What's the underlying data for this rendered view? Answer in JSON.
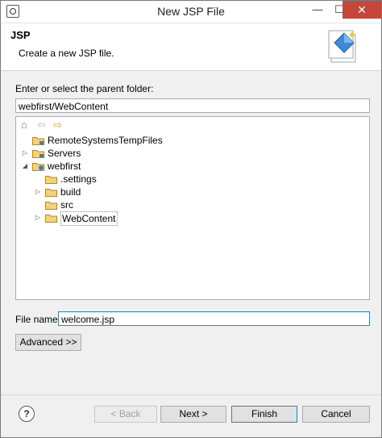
{
  "window": {
    "title": "New JSP File",
    "minimize_glyph": "—",
    "maximize_glyph": "☐",
    "close_glyph": "✕"
  },
  "header": {
    "title": "JSP",
    "description": "Create a new JSP file.",
    "icon": "jsp-wizard-icon"
  },
  "parent_folder": {
    "label": "Enter or select the parent folder:",
    "value": "webfirst/WebContent"
  },
  "tree": {
    "toolbar": [
      "home-icon",
      "back-arrow-icon",
      "forward-arrow-icon"
    ],
    "items": [
      {
        "label": "RemoteSystemsTempFiles",
        "expander": "",
        "icon": "project-folder-icon"
      },
      {
        "label": "Servers",
        "expander": "▷",
        "icon": "project-folder-icon"
      },
      {
        "label": "webfirst",
        "expander": "◢",
        "icon": "web-project-icon"
      },
      {
        "label": ".settings",
        "expander": "",
        "icon": "folder-icon"
      },
      {
        "label": "build",
        "expander": "▷",
        "icon": "folder-icon"
      },
      {
        "label": "src",
        "expander": "",
        "icon": "folder-icon"
      },
      {
        "label": "WebContent",
        "expander": "▷",
        "icon": "folder-icon"
      }
    ]
  },
  "file_name": {
    "label": "File name:",
    "value": "welcome.jsp"
  },
  "buttons": {
    "advanced": "Advanced >>",
    "back": "< Back",
    "next": "Next >",
    "finish": "Finish",
    "cancel": "Cancel",
    "help": "?"
  }
}
